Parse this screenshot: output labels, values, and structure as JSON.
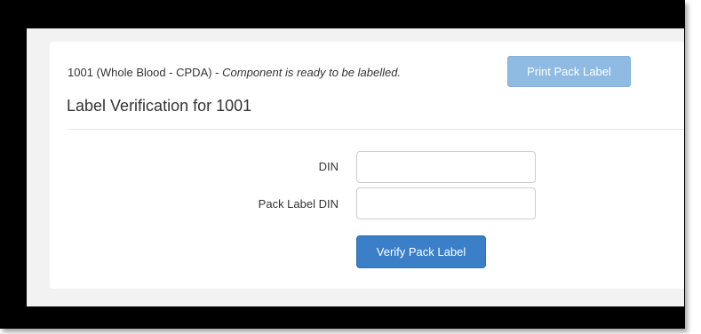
{
  "status": {
    "component_text": "1001 (Whole Blood - CPDA) -",
    "status_text": "Component is ready to be labelled.",
    "print_button_label": "Print Pack Label"
  },
  "section": {
    "title": "Label Verification for 1001"
  },
  "form": {
    "din_label": "DIN",
    "din_value": "",
    "pack_label_din_label": "Pack Label DIN",
    "pack_label_din_value": "",
    "verify_button_label": "Verify Pack Label"
  },
  "colors": {
    "print_button_bg": "#8fbbe2",
    "verify_button_bg": "#3a7fc7"
  }
}
